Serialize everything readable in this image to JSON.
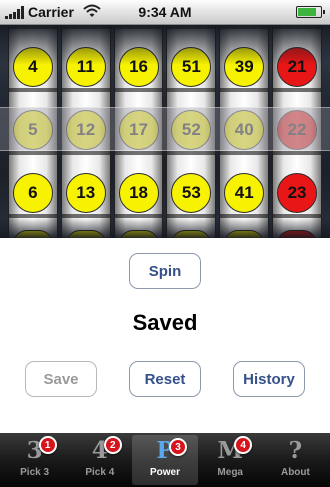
{
  "status_bar": {
    "carrier": "Carrier",
    "time": "9:34 AM",
    "battery_level": 0.85
  },
  "reels": [
    {
      "top": "4",
      "middle": "5",
      "bottom": "6",
      "color": "yellow"
    },
    {
      "top": "11",
      "middle": "12",
      "bottom": "13",
      "color": "yellow"
    },
    {
      "top": "16",
      "middle": "17",
      "bottom": "18",
      "color": "yellow"
    },
    {
      "top": "51",
      "middle": "52",
      "bottom": "53",
      "color": "yellow"
    },
    {
      "top": "39",
      "middle": "40",
      "bottom": "41",
      "color": "yellow"
    },
    {
      "top": "21",
      "middle": "22",
      "bottom": "23",
      "color": "red"
    }
  ],
  "colors": {
    "ball_yellow": "#f7f200",
    "ball_red": "#e81616",
    "button_text": "#35508a",
    "tab_active": "#5aa7ec",
    "badge": "#d5141c"
  },
  "controls": {
    "spin_label": "Spin",
    "status": "Saved",
    "save_label": "Save",
    "reset_label": "Reset",
    "history_label": "History"
  },
  "tabs": [
    {
      "glyph": "3",
      "label": "Pick 3",
      "badge": "1",
      "active": false
    },
    {
      "glyph": "4",
      "label": "Pick 4",
      "badge": "2",
      "active": false
    },
    {
      "glyph": "P",
      "label": "Power",
      "badge": "3",
      "active": true
    },
    {
      "glyph": "M",
      "label": "Mega",
      "badge": "4",
      "active": false
    },
    {
      "glyph": "?",
      "label": "About",
      "badge": "",
      "active": false
    }
  ]
}
